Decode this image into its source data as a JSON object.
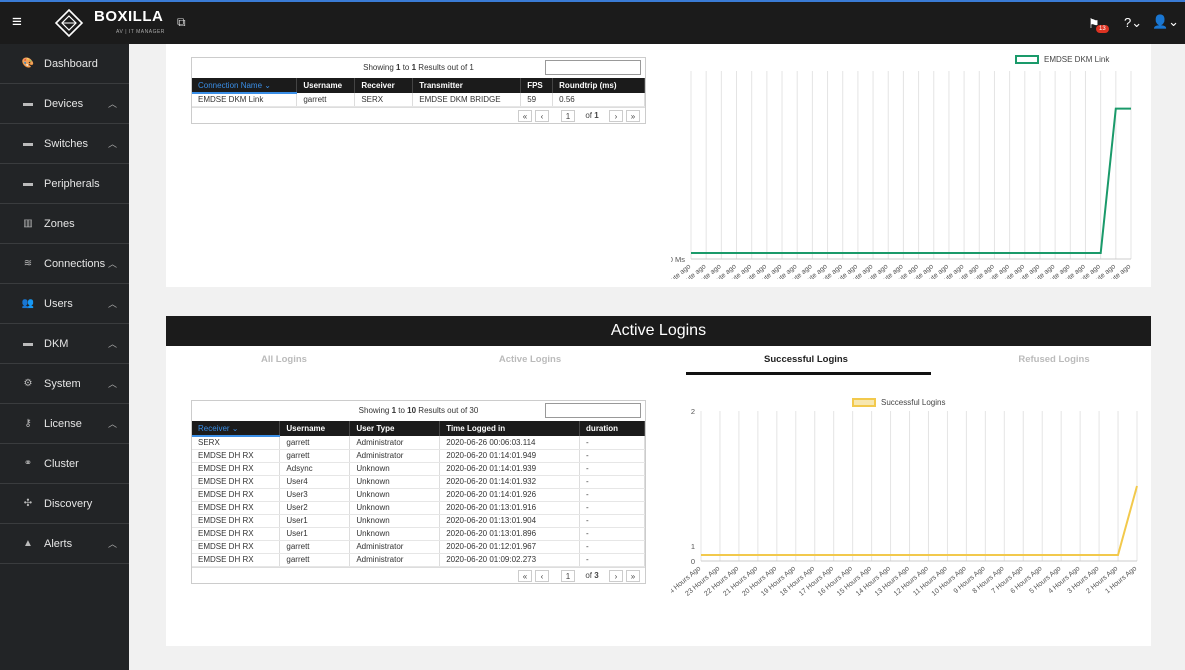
{
  "app": {
    "brand": "BOXILLA",
    "brand_sub": "AV | IT MANAGER",
    "notification_count": "13"
  },
  "sidebar": {
    "items": [
      {
        "label": "Dashboard",
        "icon": "palette-icon",
        "chevron": false
      },
      {
        "label": "Devices",
        "icon": "device-icon",
        "chevron": true
      },
      {
        "label": "Switches",
        "icon": "switch-icon",
        "chevron": true
      },
      {
        "label": "Peripherals",
        "icon": "peripheral-icon",
        "chevron": false
      },
      {
        "label": "Zones",
        "icon": "zones-icon",
        "chevron": false
      },
      {
        "label": "Connections",
        "icon": "wifi-icon",
        "chevron": true
      },
      {
        "label": "Users",
        "icon": "users-icon",
        "chevron": true
      },
      {
        "label": "DKM",
        "icon": "dkm-icon",
        "chevron": true
      },
      {
        "label": "System",
        "icon": "gear-icon",
        "chevron": true
      },
      {
        "label": "License",
        "icon": "key-icon",
        "chevron": true
      },
      {
        "label": "Cluster",
        "icon": "cluster-icon",
        "chevron": false
      },
      {
        "label": "Discovery",
        "icon": "discovery-icon",
        "chevron": false
      },
      {
        "label": "Alerts",
        "icon": "warning-icon",
        "chevron": true
      }
    ]
  },
  "connections_table": {
    "info_prefix": "Showing ",
    "info_from": "1",
    "info_mid": " to ",
    "info_to": "1",
    "info_suffix": " Results out of 1",
    "headers": [
      "Connection Name",
      "Username",
      "Receiver",
      "Transmitter",
      "FPS",
      "Roundtrip (ms)"
    ],
    "rows": [
      [
        "EMDSE DKM Link",
        "garrett",
        "SERX",
        "EMDSE DKM BRIDGE",
        "59",
        "0.56"
      ]
    ],
    "pager": {
      "first": "«",
      "prev": "‹",
      "page": "1",
      "of": "of",
      "total": "1",
      "next": "›",
      "last": "»"
    }
  },
  "dkm_chart": {
    "legend": "EMDSE DKM Link",
    "y_tick": "0 Ms",
    "x_labels": [
      "60 Minute ago",
      "58 Minute ago",
      "56 Minute ago",
      "54 Minute ago",
      "52 Minute ago",
      "50 Minute ago",
      "48 Minute ago",
      "46 Minute ago",
      "44 Minute ago",
      "42 Minute ago",
      "40 Minute ago",
      "38 Minute ago",
      "36 Minute ago",
      "34 Minute ago",
      "32 Minute ago",
      "30 Minute ago",
      "28 Minute ago",
      "26 Minute ago",
      "24 Minute ago",
      "22 Minute ago",
      "20 Minute ago",
      "18 Minute ago",
      "16 Minute ago",
      "14 Minute ago",
      "12 Minute ago",
      "10 Minute ago",
      "8 Minute ago",
      "6 Minute ago",
      "4 Minute ago",
      "2 Minute ago"
    ],
    "color": "#1a9a6a"
  },
  "chart_data": [
    {
      "type": "line",
      "x": [
        "60 Minute ago",
        "58 Minute ago",
        "56 Minute ago",
        "54 Minute ago",
        "52 Minute ago",
        "50 Minute ago",
        "48 Minute ago",
        "46 Minute ago",
        "44 Minute ago",
        "42 Minute ago",
        "40 Minute ago",
        "38 Minute ago",
        "36 Minute ago",
        "34 Minute ago",
        "32 Minute ago",
        "30 Minute ago",
        "28 Minute ago",
        "26 Minute ago",
        "24 Minute ago",
        "22 Minute ago",
        "20 Minute ago",
        "18 Minute ago",
        "16 Minute ago",
        "14 Minute ago",
        "12 Minute ago",
        "10 Minute ago",
        "8 Minute ago",
        "6 Minute ago",
        "4 Minute ago",
        "2 Minute ago"
      ],
      "series": [
        {
          "name": "EMDSE DKM Link",
          "values": [
            0,
            0,
            0,
            0,
            0,
            0,
            0,
            0,
            0,
            0,
            0,
            0,
            0,
            0,
            0,
            0,
            0,
            0,
            0,
            0,
            0,
            0,
            0,
            0,
            0,
            0,
            0,
            0,
            0.56,
            0.56
          ]
        }
      ],
      "y_ticks": [
        "0 Ms"
      ],
      "grid": true,
      "legend": "top"
    },
    {
      "type": "line",
      "x": [
        "24 Hours Ago",
        "23 Hours Ago",
        "22 Hours Ago",
        "21 Hours Ago",
        "20 Hours Ago",
        "19 Hours Ago",
        "18 Hours Ago",
        "17 Hours Ago",
        "16 Hours Ago",
        "15 Hours Ago",
        "14 Hours Ago",
        "13 Hours Ago",
        "12 Hours Ago",
        "11 Hours Ago",
        "10 Hours Ago",
        "9 Hours Ago",
        "8 Hours Ago",
        "7 Hours Ago",
        "6 Hours Ago",
        "5 Hours Ago",
        "4 Hours Ago",
        "3 Hours Ago",
        "2 Hours Ago",
        "1 Hours Ago"
      ],
      "series": [
        {
          "name": "Successful Logins",
          "values": [
            0,
            0,
            0,
            0,
            0,
            0,
            0,
            0,
            0,
            0,
            0,
            0,
            0,
            0,
            0,
            0,
            0,
            0,
            0,
            0,
            0,
            0,
            0,
            1
          ]
        }
      ],
      "y_ticks": [
        "0",
        "1",
        "2"
      ],
      "ylim": [
        0,
        2
      ],
      "grid": true,
      "legend": "top"
    }
  ],
  "logins": {
    "title": "Active Logins",
    "tabs": [
      "All Logins",
      "Active Logins",
      "Successful Logins",
      "Refused Logins"
    ],
    "active_tab": 2,
    "info_prefix": "Showing ",
    "info_from": "1",
    "info_mid": " to ",
    "info_to": "10",
    "info_suffix": " Results out of 30",
    "headers": [
      "Receiver",
      "Username",
      "User Type",
      "Time Logged in",
      "duration"
    ],
    "rows": [
      [
        "SERX",
        "garrett",
        "Administrator",
        "2020-06-26 00:06:03.114",
        "-"
      ],
      [
        "EMDSE DH RX",
        "garrett",
        "Administrator",
        "2020-06-20 01:14:01.949",
        "-"
      ],
      [
        "EMDSE DH RX",
        "Adsync",
        "Unknown",
        "2020-06-20 01:14:01.939",
        "-"
      ],
      [
        "EMDSE DH RX",
        "User4",
        "Unknown",
        "2020-06-20 01:14:01.932",
        "-"
      ],
      [
        "EMDSE DH RX",
        "User3",
        "Unknown",
        "2020-06-20 01:14:01.926",
        "-"
      ],
      [
        "EMDSE DH RX",
        "User2",
        "Unknown",
        "2020-06-20 01:13:01.916",
        "-"
      ],
      [
        "EMDSE DH RX",
        "User1",
        "Unknown",
        "2020-06-20 01:13:01.904",
        "-"
      ],
      [
        "EMDSE DH RX",
        "User1",
        "Unknown",
        "2020-06-20 01:13:01.896",
        "-"
      ],
      [
        "EMDSE DH RX",
        "garrett",
        "Administrator",
        "2020-06-20 01:12:01.967",
        "-"
      ],
      [
        "EMDSE DH RX",
        "garrett",
        "Administrator",
        "2020-06-20 01:09:02.273",
        "-"
      ]
    ],
    "pager": {
      "first": "«",
      "prev": "‹",
      "page": "1",
      "of": "of",
      "total": "3",
      "next": "›",
      "last": "»"
    }
  },
  "logins_chart": {
    "legend": "Successful Logins",
    "y_ticks": [
      "2",
      "1",
      "0"
    ],
    "x_labels": [
      "24 Hours Ago",
      "23 Hours Ago",
      "22 Hours Ago",
      "21 Hours Ago",
      "20 Hours Ago",
      "19 Hours Ago",
      "18 Hours Ago",
      "17 Hours Ago",
      "16 Hours Ago",
      "15 Hours Ago",
      "14 Hours Ago",
      "13 Hours Ago",
      "12 Hours Ago",
      "11 Hours Ago",
      "10 Hours Ago",
      "9 Hours Ago",
      "8 Hours Ago",
      "7 Hours Ago",
      "6 Hours Ago",
      "5 Hours Ago",
      "4 Hours Ago",
      "3 Hours Ago",
      "2 Hours Ago",
      "1 Hours Ago"
    ],
    "color": "#f2c94c"
  }
}
